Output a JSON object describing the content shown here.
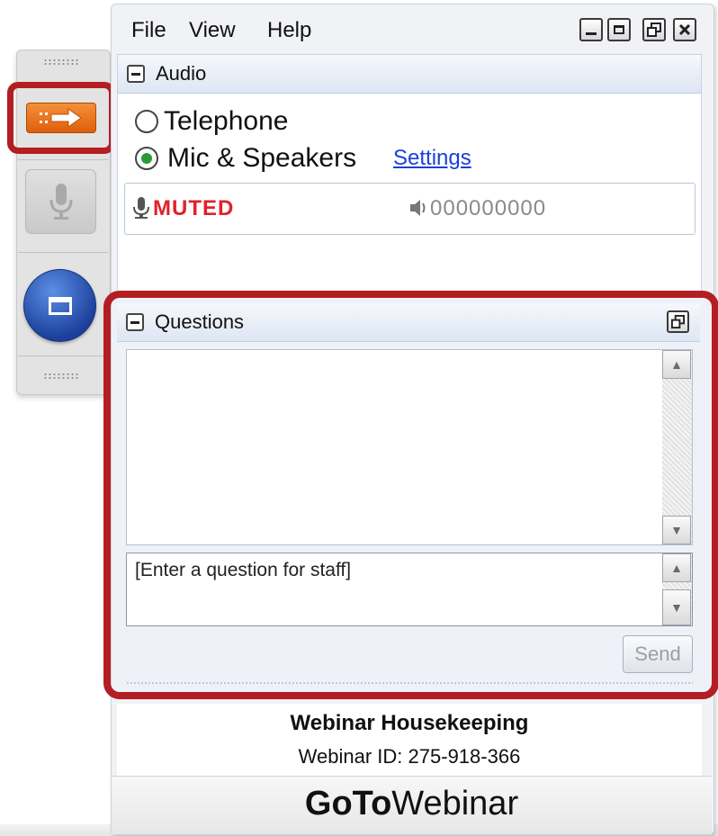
{
  "menu": {
    "file": "File",
    "view": "View",
    "help": "Help"
  },
  "audio": {
    "title": "Audio",
    "options": [
      {
        "label": "Telephone",
        "selected": false
      },
      {
        "label": "Mic & Speakers",
        "selected": true
      }
    ],
    "settings_link": "Settings",
    "muted_label": "MUTED",
    "volume_meter": "000000000"
  },
  "questions": {
    "title": "Questions",
    "input_placeholder": "[Enter a question for staff]",
    "send_label": "Send"
  },
  "webinar": {
    "title": "Webinar Housekeeping",
    "id_line": "Webinar ID: 275-918-366"
  },
  "brand": {
    "bold": "GoTo",
    "regular": "Webinar"
  },
  "colors": {
    "highlight": "#b31e23",
    "muted": "#e0222a",
    "link": "#1a3fd8",
    "accent_orange": "#e8711c"
  },
  "icons": [
    "exit-arrow-icon",
    "microphone-icon",
    "screen-icon",
    "minimize-icon",
    "maximize-icon",
    "restore-icon",
    "close-icon",
    "speaker-icon",
    "popout-icon"
  ]
}
